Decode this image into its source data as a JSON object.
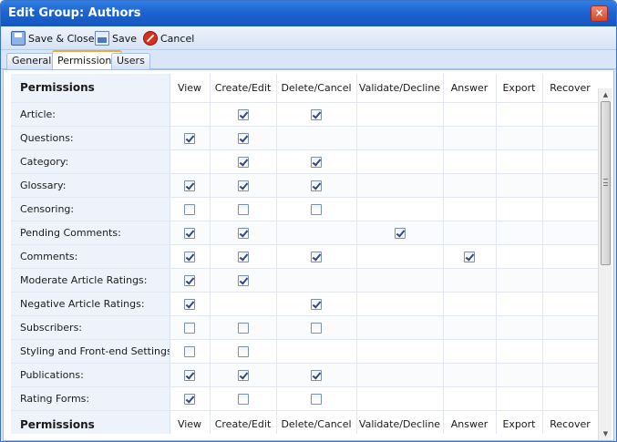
{
  "window": {
    "title": "Edit Group: Authors",
    "close_glyph": "×"
  },
  "toolbar": {
    "save_close_label": "Save & Close",
    "save_label": "Save",
    "cancel_label": "Cancel",
    "icons": {
      "save_close": "save-close-icon",
      "save": "save-icon",
      "cancel": "cancel-icon"
    }
  },
  "tabs": [
    {
      "label": "General",
      "active": false
    },
    {
      "label": "Permissions",
      "active": true
    },
    {
      "label": "Users",
      "active": false
    }
  ],
  "grid": {
    "header": [
      "Permissions",
      "View",
      "Create/Edit",
      "Delete/Cancel",
      "Validate/Decline",
      "Answer",
      "Export",
      "Recover"
    ],
    "rows": [
      {
        "label": "Article:",
        "cells": [
          null,
          true,
          true,
          null,
          null,
          null,
          null
        ]
      },
      {
        "label": "Questions:",
        "cells": [
          true,
          true,
          null,
          null,
          null,
          null,
          null
        ]
      },
      {
        "label": "Category:",
        "cells": [
          null,
          true,
          true,
          null,
          null,
          null,
          null
        ]
      },
      {
        "label": "Glossary:",
        "cells": [
          true,
          true,
          true,
          null,
          null,
          null,
          null
        ]
      },
      {
        "label": "Censoring:",
        "cells": [
          false,
          false,
          false,
          null,
          null,
          null,
          null
        ]
      },
      {
        "label": "Pending Comments:",
        "cells": [
          true,
          true,
          null,
          true,
          null,
          null,
          null
        ]
      },
      {
        "label": "Comments:",
        "cells": [
          true,
          true,
          true,
          null,
          true,
          null,
          null
        ]
      },
      {
        "label": "Moderate Article Ratings:",
        "cells": [
          true,
          true,
          null,
          null,
          null,
          null,
          null
        ]
      },
      {
        "label": "Negative Article Ratings:",
        "cells": [
          true,
          null,
          true,
          null,
          null,
          null,
          null
        ]
      },
      {
        "label": "Subscribers:",
        "cells": [
          false,
          false,
          false,
          null,
          null,
          null,
          null
        ]
      },
      {
        "label": "Styling and Front-end Settings:",
        "cells": [
          false,
          false,
          null,
          null,
          null,
          null,
          null
        ]
      },
      {
        "label": "Publications:",
        "cells": [
          true,
          true,
          true,
          null,
          null,
          null,
          null
        ]
      },
      {
        "label": "Rating Forms:",
        "cells": [
          true,
          false,
          false,
          null,
          null,
          null,
          null
        ]
      }
    ]
  },
  "colors": {
    "titlebar": "#1d63cf",
    "panel_bg": "#d9e6f7",
    "label_column": "#eef3fb",
    "active_tab_accent": "#f0a93a"
  }
}
